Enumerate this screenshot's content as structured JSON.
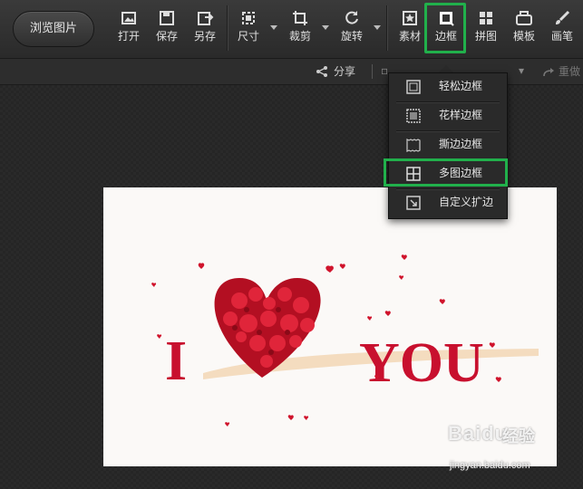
{
  "toolbar": {
    "browse_label": "浏览图片",
    "tools": [
      {
        "id": "open",
        "label": "打开",
        "icon": "open-image-icon"
      },
      {
        "id": "save",
        "label": "保存",
        "icon": "save-icon"
      },
      {
        "id": "save_as",
        "label": "另存",
        "icon": "save-as-icon"
      },
      {
        "id": "size",
        "label": "尺寸",
        "icon": "resize-icon"
      },
      {
        "id": "crop",
        "label": "裁剪",
        "icon": "crop-icon"
      },
      {
        "id": "rotate",
        "label": "旋转",
        "icon": "rotate-icon"
      },
      {
        "id": "material",
        "label": "素材",
        "icon": "star-sticker-icon"
      },
      {
        "id": "border",
        "label": "边框",
        "icon": "border-frame-icon",
        "highlighted": true
      },
      {
        "id": "collage",
        "label": "拼图",
        "icon": "grid-collage-icon"
      },
      {
        "id": "template",
        "label": "模板",
        "icon": "template-icon"
      },
      {
        "id": "brush",
        "label": "画笔",
        "icon": "brush-icon"
      }
    ]
  },
  "subbar": {
    "share_label": "分享",
    "redo_label": "重做"
  },
  "border_menu": {
    "items": [
      {
        "label": "轻松边框",
        "icon": "simple-border-icon"
      },
      {
        "label": "花样边框",
        "icon": "pattern-border-icon"
      },
      {
        "label": "撕边边框",
        "icon": "torn-edge-border-icon"
      },
      {
        "label": "多图边框",
        "icon": "multi-image-border-icon",
        "highlighted": true
      },
      {
        "label": "自定义扩边",
        "icon": "custom-expand-border-icon"
      }
    ]
  },
  "photo": {
    "text_left": "I",
    "text_right": "YOU"
  },
  "watermark": {
    "logo": "Baidu",
    "sub": "经验",
    "url": "jingyan.baidu.com"
  },
  "colors": {
    "highlight": "#21b04b",
    "toolbar_bg": "#333333",
    "photo_red": "#c8102e"
  }
}
